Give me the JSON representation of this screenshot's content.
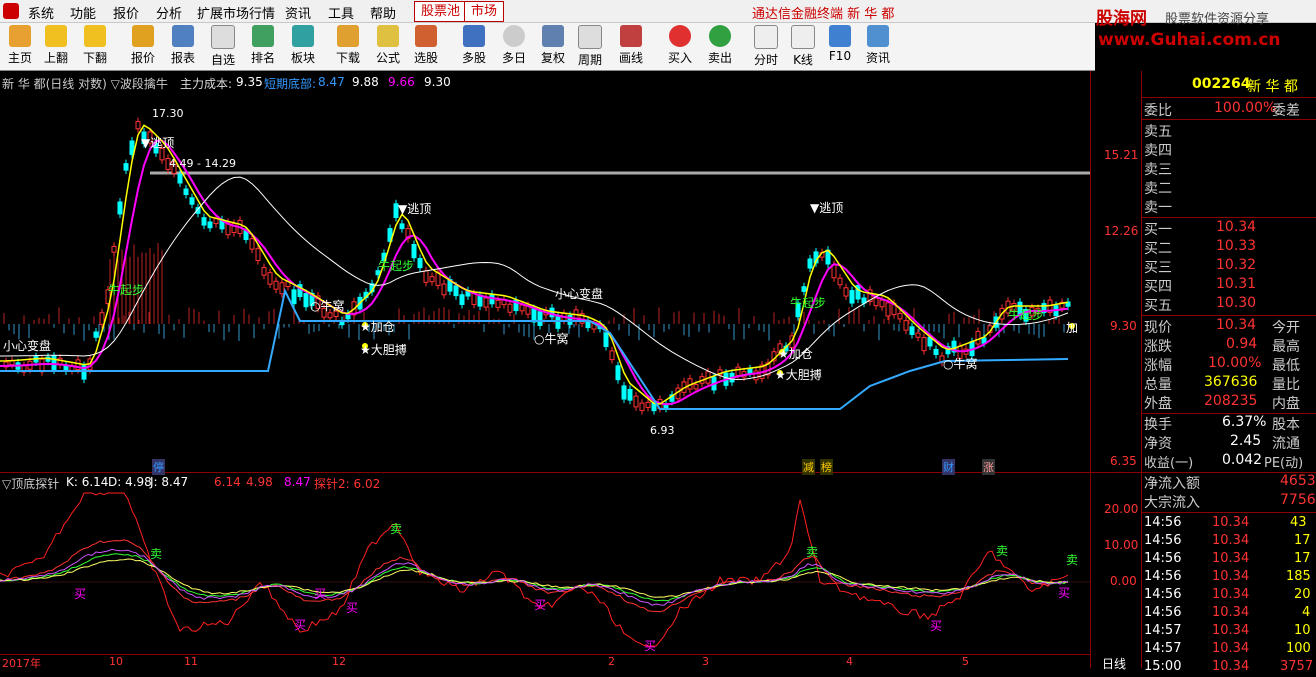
{
  "menu": [
    "系统",
    "功能",
    "报价",
    "分析",
    "扩展市场行情",
    "资讯",
    "工具",
    "帮助"
  ],
  "menu_tabs": [
    "股票池",
    "市场"
  ],
  "window_title": "通达信金融终端 新 华 都",
  "brand": {
    "name": "股海网",
    "slogan": "股票软件资源分享",
    "url": "www.Guhai.com.cn"
  },
  "toolbar": [
    "主页",
    "上翻",
    "下翻",
    "报价",
    "报表",
    "自选",
    "排名",
    "板块",
    "下载",
    "公式",
    "选股",
    "多股",
    "多日",
    "复权",
    "周期",
    "画线",
    "买入",
    "卖出",
    "分时",
    "K线",
    "F10",
    "资讯"
  ],
  "chart_header": {
    "title": "新 华 都(日线 对数) ▽波段擒牛",
    "cost_label": "主力成本:",
    "cost_value": "9.35",
    "bottom_label": "短期底部:",
    "v1": "8.47",
    "v2": "9.88",
    "v3": "9.66",
    "v4": "9.30"
  },
  "price_axis": [
    "15.21",
    "12.26",
    "9.30",
    "6.35"
  ],
  "annotations": {
    "high": "17.30",
    "range": "4.49 - 14.29",
    "escape": "▼逃顶",
    "bull": "牛起步",
    "careful": "小心变盘",
    "add": "★加仓",
    "bold": "★大胆搏",
    "nest": "○牛窝",
    "low": "6.93",
    "add_short": "加"
  },
  "event_markers": [
    "停",
    "减",
    "榜",
    "财",
    "涨"
  ],
  "indicator_header": {
    "name": "▽顶底探针",
    "k": "K: 6.14",
    "d": "D: 4.98",
    "j": "J: 8.47",
    "r1": "6.14",
    "r2": "4.98",
    "r3": "8.47",
    "probe": "探针2: 6.02"
  },
  "indicator_axis": [
    "20.00",
    "10.00",
    "0.00"
  ],
  "signals": {
    "buy": "买",
    "sell": "卖"
  },
  "x_axis": [
    "2017年",
    "10",
    "11",
    "12",
    "2",
    "3",
    "4",
    "5"
  ],
  "x_period": "日线",
  "quote": {
    "code": "002264",
    "name": "新 华 都",
    "wei_bi_label": "委比",
    "wei_bi": "100.00%",
    "wei_cha_label": "委差",
    "sells": [
      {
        "label": "卖五",
        "price": ""
      },
      {
        "label": "卖四",
        "price": ""
      },
      {
        "label": "卖三",
        "price": ""
      },
      {
        "label": "卖二",
        "price": ""
      },
      {
        "label": "卖一",
        "price": ""
      }
    ],
    "buys": [
      {
        "label": "买一",
        "price": "10.34"
      },
      {
        "label": "买二",
        "price": "10.33"
      },
      {
        "label": "买三",
        "price": "10.32"
      },
      {
        "label": "买四",
        "price": "10.31"
      },
      {
        "label": "买五",
        "price": "10.30"
      }
    ],
    "stats": [
      {
        "l": "现价",
        "v": "10.34",
        "r": "今开"
      },
      {
        "l": "涨跌",
        "v": "0.94",
        "r": "最高"
      },
      {
        "l": "涨幅",
        "v": "10.00%",
        "r": "最低"
      },
      {
        "l": "总量",
        "v": "367636",
        "r": "量比"
      },
      {
        "l": "外盘",
        "v": "208235",
        "r": "内盘"
      },
      {
        "l": "换手",
        "v": "6.37%",
        "r": "股本"
      },
      {
        "l": "净资",
        "v": "2.45",
        "r": "流通"
      },
      {
        "l": "收益(一)",
        "v": "0.042",
        "r": "PE(动)"
      }
    ],
    "flows": [
      {
        "l": "净流入额",
        "v": "4653"
      },
      {
        "l": "大宗流入",
        "v": "7756"
      }
    ],
    "ticks": [
      {
        "t": "14:56",
        "p": "10.34",
        "v": "43"
      },
      {
        "t": "14:56",
        "p": "10.34",
        "v": "17"
      },
      {
        "t": "14:56",
        "p": "10.34",
        "v": "17"
      },
      {
        "t": "14:56",
        "p": "10.34",
        "v": "185"
      },
      {
        "t": "14:56",
        "p": "10.34",
        "v": "20"
      },
      {
        "t": "14:56",
        "p": "10.34",
        "v": "4"
      },
      {
        "t": "14:57",
        "p": "10.34",
        "v": "10"
      },
      {
        "t": "14:57",
        "p": "10.34",
        "v": "100"
      },
      {
        "t": "15:00",
        "p": "10.34",
        "v": "3757"
      }
    ]
  },
  "colors": {
    "up": "#ff3333",
    "down": "#00ffff",
    "yellow": "#ffff00",
    "magenta": "#ff00ff",
    "white": "#ffffff",
    "blue": "#3399ff",
    "frame": "#8b0000"
  }
}
